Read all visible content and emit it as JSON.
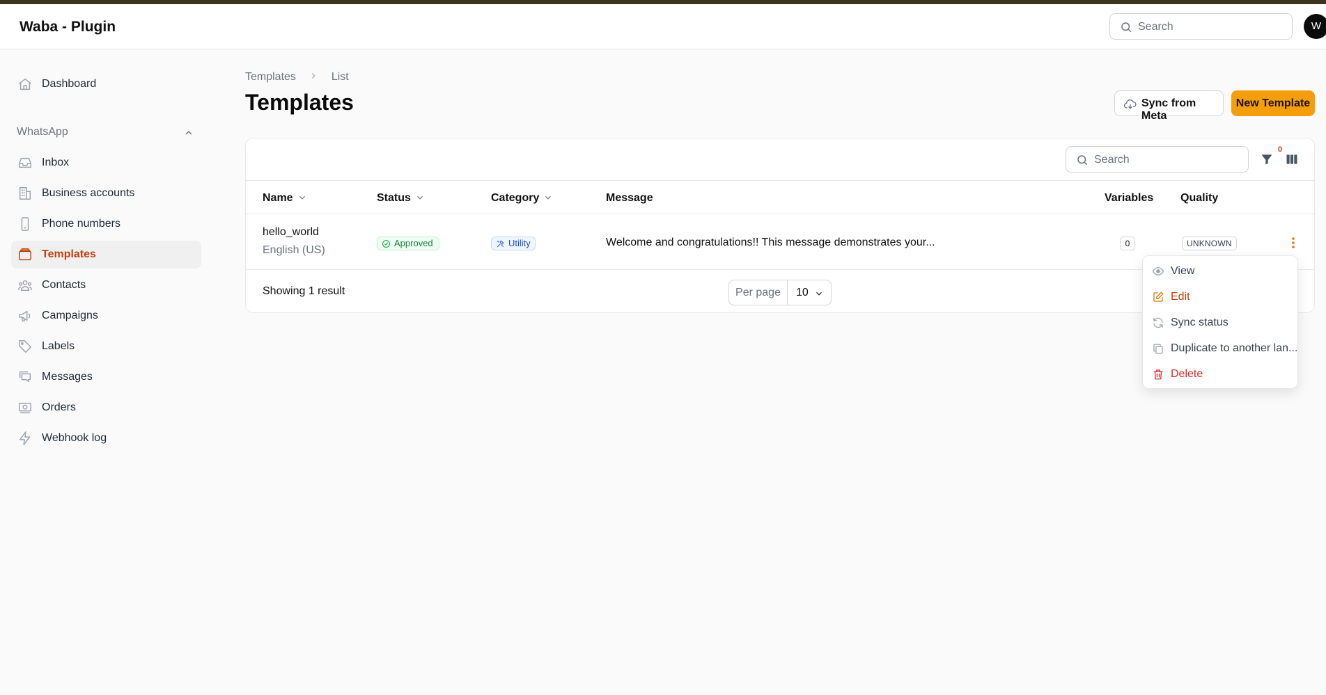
{
  "app": {
    "title": "Waba - Plugin",
    "avatar_initial": "W"
  },
  "header": {
    "search_placeholder": "Search"
  },
  "sidebar": {
    "dashboard": "Dashboard",
    "group_label": "WhatsApp",
    "items": [
      {
        "label": "Inbox",
        "icon": "inbox-icon"
      },
      {
        "label": "Business accounts",
        "icon": "building-icon"
      },
      {
        "label": "Phone numbers",
        "icon": "phone-icon"
      },
      {
        "label": "Templates",
        "icon": "template-icon",
        "active": true
      },
      {
        "label": "Contacts",
        "icon": "users-icon"
      },
      {
        "label": "Campaigns",
        "icon": "megaphone-icon"
      },
      {
        "label": "Labels",
        "icon": "tag-icon"
      },
      {
        "label": "Messages",
        "icon": "messages-icon"
      },
      {
        "label": "Orders",
        "icon": "orders-icon"
      },
      {
        "label": "Webhook log",
        "icon": "bolt-icon"
      }
    ]
  },
  "breadcrumb": {
    "parent": "Templates",
    "current": "List"
  },
  "page": {
    "title": "Templates"
  },
  "actions": {
    "sync": "Sync from Meta",
    "new": "New Template"
  },
  "table": {
    "search_placeholder": "Search",
    "filter_count": "0",
    "columns": {
      "name": "Name",
      "status": "Status",
      "category": "Category",
      "message": "Message",
      "variables": "Variables",
      "quality": "Quality"
    },
    "rows": [
      {
        "name": "hello_world",
        "language": "English (US)",
        "status": "Approved",
        "category": "Utility",
        "message": "Welcome and congratulations!! This message demonstrates your...",
        "variables": "0",
        "quality": "UNKNOWN"
      }
    ],
    "showing": "Showing 1 result",
    "per_page_label": "Per page",
    "per_page_value": "10"
  },
  "row_menu": {
    "view": "View",
    "edit": "Edit",
    "sync_status": "Sync status",
    "duplicate": "Duplicate to another lan...",
    "delete": "Delete"
  },
  "colors": {
    "accent": "#f59e0b",
    "active": "#c2410c",
    "danger": "#dc2626"
  }
}
